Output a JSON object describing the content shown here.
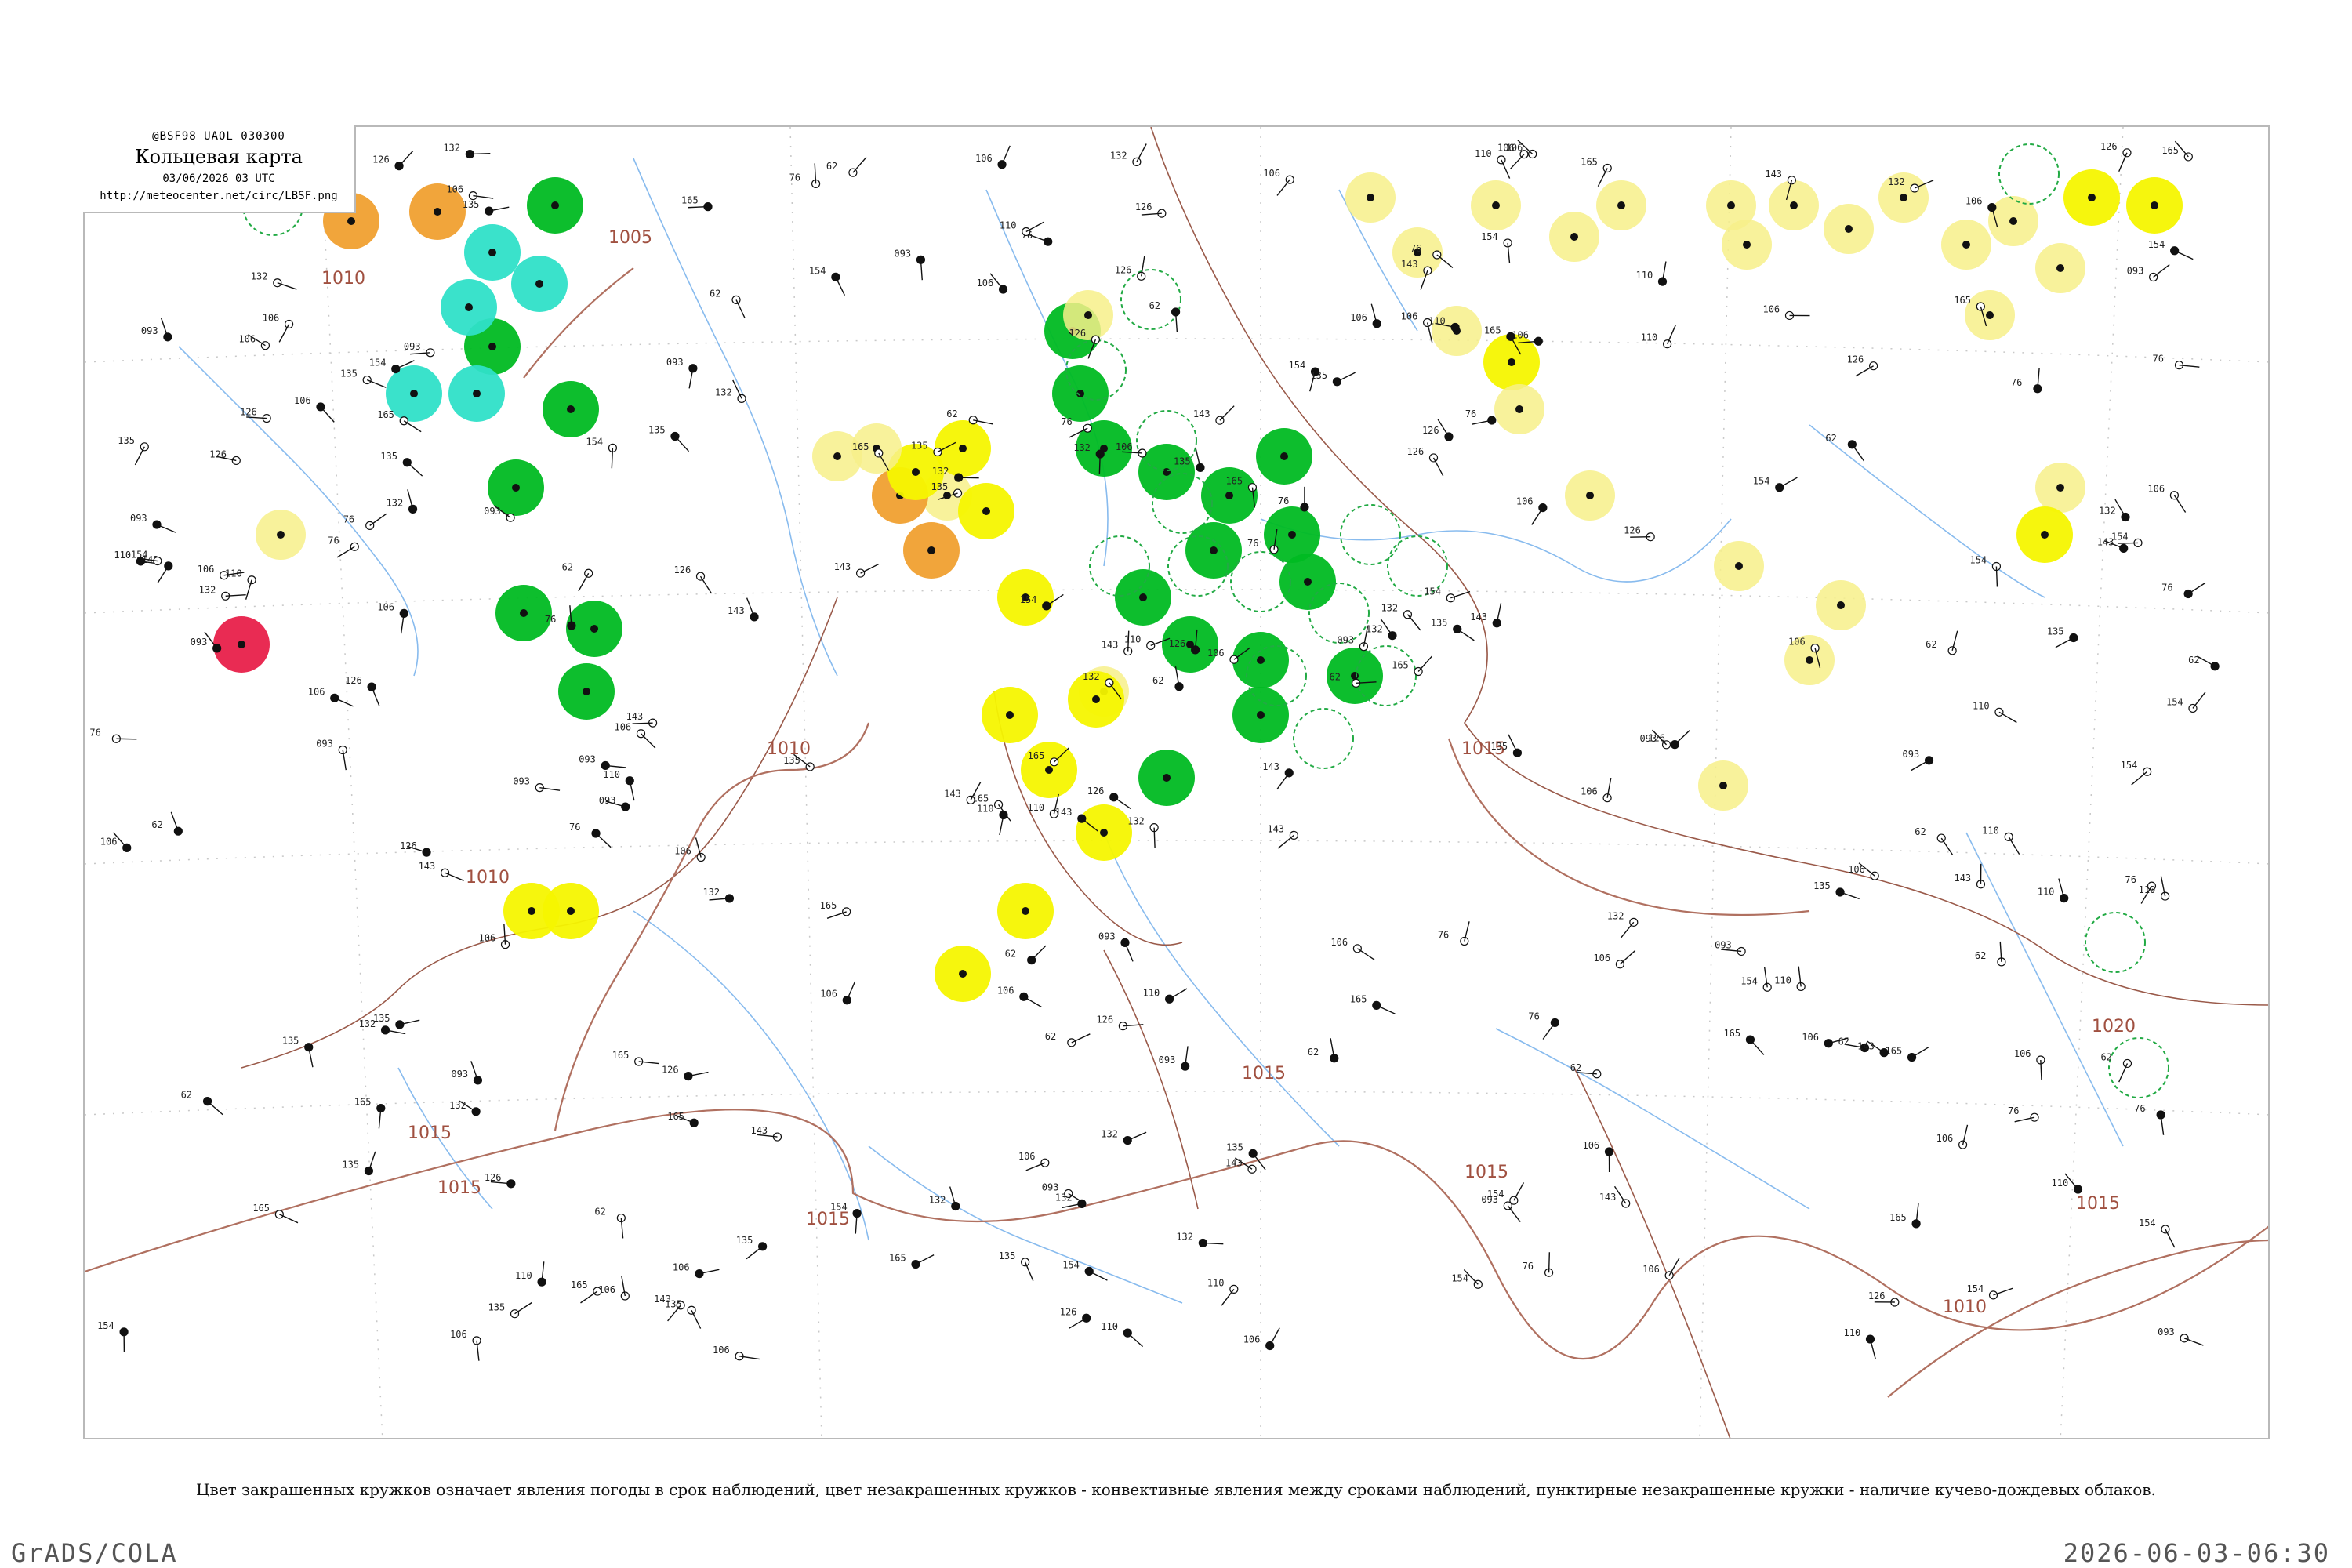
{
  "header": {
    "code": "@BSF98  UAOL  030300",
    "title": "Кольцевая карта",
    "date": "03/06/2026 03 UTC",
    "url": "http://meteocenter.net/circ/LBSF.png"
  },
  "isobars": [
    "1005",
    "1010",
    "1010",
    "1010",
    "1015",
    "1015",
    "1015",
    "1015",
    "1015",
    "1015",
    "1010",
    "1020",
    "1015"
  ],
  "weather_colors": {
    "green": "#00bb22",
    "yellow": "#f5f500",
    "pale_yellow": "#f7f08a",
    "orange": "#f0a030",
    "cyan": "#2fe0c8",
    "red": "#e8204a",
    "isobar": "#b07060",
    "river": "#88bbee"
  },
  "stations": [
    {
      "n": "132",
      "c": "green"
    },
    {
      "n": "165",
      "c": "green"
    },
    {
      "n": "093",
      "c": "cyan"
    },
    {
      "n": "154",
      "c": "yellow"
    },
    {
      "n": "106",
      "c": "yellow"
    },
    {
      "n": "135",
      "c": "yellow"
    },
    {
      "n": "126",
      "c": "pale_yellow"
    },
    {
      "n": "110",
      "c": "pale_yellow"
    },
    {
      "n": "106",
      "c": "orange"
    },
    {
      "n": "76",
      "c": "orange"
    },
    {
      "n": "143",
      "c": "green"
    },
    {
      "n": "62",
      "c": "yellow"
    }
  ],
  "caption": "Цвет закрашенных кружков означает явления погоды в срок наблюдений, цвет незакрашенных кружков - конвективные явления между сроками наблюдений, пунктирные незакрашенные кружки - наличие кучево-дождевых облаков.",
  "footer": {
    "left": "GrADS/COLA",
    "right": "2026-06-03-06:30"
  }
}
